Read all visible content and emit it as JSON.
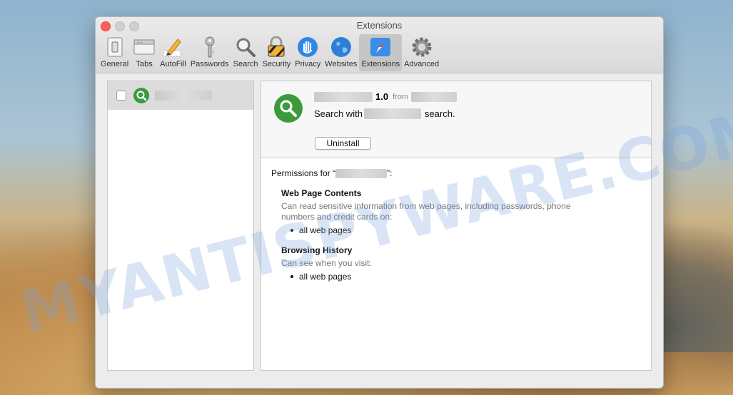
{
  "window": {
    "title": "Extensions"
  },
  "toolbar": {
    "items": [
      {
        "label": "General",
        "icon": "general-switch-icon"
      },
      {
        "label": "Tabs",
        "icon": "tabs-icon"
      },
      {
        "label": "AutoFill",
        "icon": "pencil-icon"
      },
      {
        "label": "Passwords",
        "icon": "key-icon"
      },
      {
        "label": "Search",
        "icon": "magnifier-icon"
      },
      {
        "label": "Security",
        "icon": "padlock-icon"
      },
      {
        "label": "Privacy",
        "icon": "hand-icon"
      },
      {
        "label": "Websites",
        "icon": "globe-icon"
      },
      {
        "label": "Extensions",
        "icon": "compass-icon"
      },
      {
        "label": "Advanced",
        "icon": "gear-icon"
      }
    ],
    "active": "Extensions"
  },
  "extension": {
    "version": "1.0",
    "from_label": "from",
    "search_prefix": "Search with",
    "search_suffix": "search.",
    "uninstall_label": "Uninstall"
  },
  "permissions": {
    "title_prefix": "Permissions for “",
    "title_suffix": "”:",
    "sections": [
      {
        "heading": "Web Page Contents",
        "description": "Can read sensitive information from web pages, including passwords, phone numbers and credit cards on:",
        "item": "all web pages"
      },
      {
        "heading": "Browsing History",
        "description": "Can see when you visit:",
        "item": "all web pages"
      }
    ]
  },
  "watermark": "MYANTISPYWARE.COM",
  "colors": {
    "accent": "#3c9a3c",
    "close": "#fe5f57",
    "active_tab": "#c6c6c6"
  }
}
